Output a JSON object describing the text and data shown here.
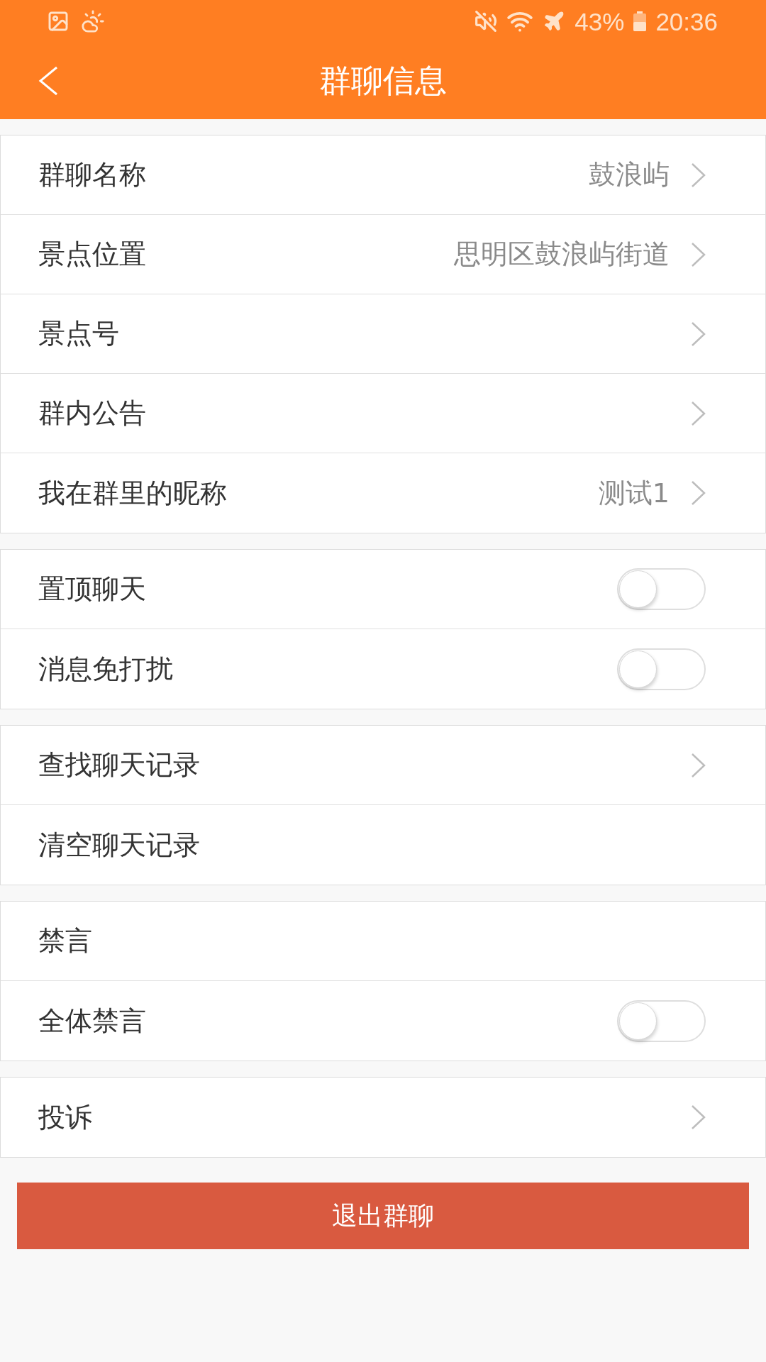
{
  "status_bar": {
    "battery": "43%",
    "time": "20:36"
  },
  "header": {
    "title": "群聊信息"
  },
  "groups": [
    {
      "rows": [
        {
          "kind": "link",
          "label": "群聊名称",
          "value": "鼓浪屿"
        },
        {
          "kind": "link",
          "label": "景点位置",
          "value": "思明区鼓浪屿街道"
        },
        {
          "kind": "link",
          "label": "景点号"
        },
        {
          "kind": "link",
          "label": "群内公告"
        },
        {
          "kind": "link",
          "label": "我在群里的昵称",
          "value": "测试1"
        }
      ]
    },
    {
      "rows": [
        {
          "kind": "switch",
          "label": "置顶聊天",
          "on": false
        },
        {
          "kind": "switch",
          "label": "消息免打扰",
          "on": false
        }
      ]
    },
    {
      "rows": [
        {
          "kind": "link",
          "label": "查找聊天记录"
        },
        {
          "kind": "plain",
          "label": "清空聊天记录"
        }
      ]
    },
    {
      "rows": [
        {
          "kind": "plain",
          "label": "禁言"
        },
        {
          "kind": "switch",
          "label": "全体禁言",
          "on": false
        }
      ]
    },
    {
      "rows": [
        {
          "kind": "link",
          "label": "投诉"
        }
      ]
    }
  ],
  "exit_button": {
    "label": "退出群聊"
  }
}
